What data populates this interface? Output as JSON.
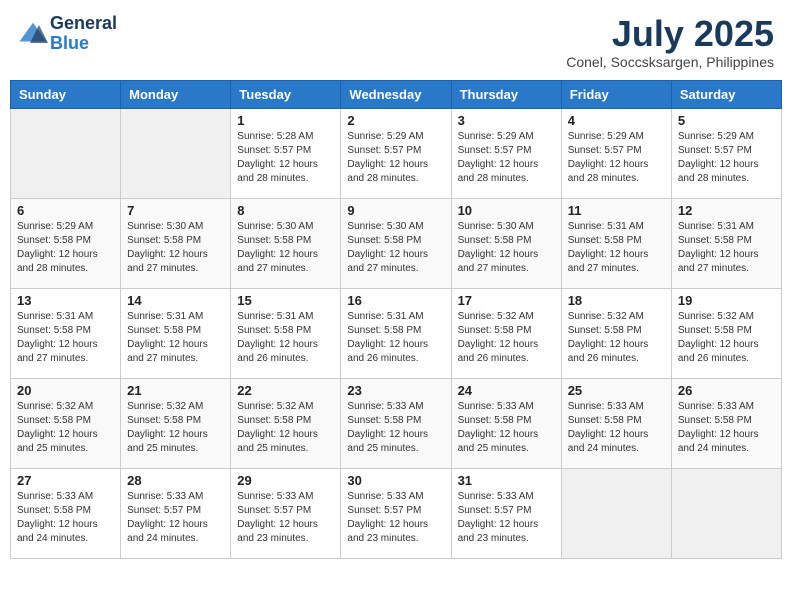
{
  "logo": {
    "line1": "General",
    "line2": "Blue"
  },
  "title": "July 2025",
  "subtitle": "Conel, Soccsksargen, Philippines",
  "weekdays": [
    "Sunday",
    "Monday",
    "Tuesday",
    "Wednesday",
    "Thursday",
    "Friday",
    "Saturday"
  ],
  "weeks": [
    [
      {
        "day": "",
        "sunrise": "",
        "sunset": "",
        "daylight": ""
      },
      {
        "day": "",
        "sunrise": "",
        "sunset": "",
        "daylight": ""
      },
      {
        "day": "1",
        "sunrise": "Sunrise: 5:28 AM",
        "sunset": "Sunset: 5:57 PM",
        "daylight": "Daylight: 12 hours and 28 minutes."
      },
      {
        "day": "2",
        "sunrise": "Sunrise: 5:29 AM",
        "sunset": "Sunset: 5:57 PM",
        "daylight": "Daylight: 12 hours and 28 minutes."
      },
      {
        "day": "3",
        "sunrise": "Sunrise: 5:29 AM",
        "sunset": "Sunset: 5:57 PM",
        "daylight": "Daylight: 12 hours and 28 minutes."
      },
      {
        "day": "4",
        "sunrise": "Sunrise: 5:29 AM",
        "sunset": "Sunset: 5:57 PM",
        "daylight": "Daylight: 12 hours and 28 minutes."
      },
      {
        "day": "5",
        "sunrise": "Sunrise: 5:29 AM",
        "sunset": "Sunset: 5:57 PM",
        "daylight": "Daylight: 12 hours and 28 minutes."
      }
    ],
    [
      {
        "day": "6",
        "sunrise": "Sunrise: 5:29 AM",
        "sunset": "Sunset: 5:58 PM",
        "daylight": "Daylight: 12 hours and 28 minutes."
      },
      {
        "day": "7",
        "sunrise": "Sunrise: 5:30 AM",
        "sunset": "Sunset: 5:58 PM",
        "daylight": "Daylight: 12 hours and 27 minutes."
      },
      {
        "day": "8",
        "sunrise": "Sunrise: 5:30 AM",
        "sunset": "Sunset: 5:58 PM",
        "daylight": "Daylight: 12 hours and 27 minutes."
      },
      {
        "day": "9",
        "sunrise": "Sunrise: 5:30 AM",
        "sunset": "Sunset: 5:58 PM",
        "daylight": "Daylight: 12 hours and 27 minutes."
      },
      {
        "day": "10",
        "sunrise": "Sunrise: 5:30 AM",
        "sunset": "Sunset: 5:58 PM",
        "daylight": "Daylight: 12 hours and 27 minutes."
      },
      {
        "day": "11",
        "sunrise": "Sunrise: 5:31 AM",
        "sunset": "Sunset: 5:58 PM",
        "daylight": "Daylight: 12 hours and 27 minutes."
      },
      {
        "day": "12",
        "sunrise": "Sunrise: 5:31 AM",
        "sunset": "Sunset: 5:58 PM",
        "daylight": "Daylight: 12 hours and 27 minutes."
      }
    ],
    [
      {
        "day": "13",
        "sunrise": "Sunrise: 5:31 AM",
        "sunset": "Sunset: 5:58 PM",
        "daylight": "Daylight: 12 hours and 27 minutes."
      },
      {
        "day": "14",
        "sunrise": "Sunrise: 5:31 AM",
        "sunset": "Sunset: 5:58 PM",
        "daylight": "Daylight: 12 hours and 27 minutes."
      },
      {
        "day": "15",
        "sunrise": "Sunrise: 5:31 AM",
        "sunset": "Sunset: 5:58 PM",
        "daylight": "Daylight: 12 hours and 26 minutes."
      },
      {
        "day": "16",
        "sunrise": "Sunrise: 5:31 AM",
        "sunset": "Sunset: 5:58 PM",
        "daylight": "Daylight: 12 hours and 26 minutes."
      },
      {
        "day": "17",
        "sunrise": "Sunrise: 5:32 AM",
        "sunset": "Sunset: 5:58 PM",
        "daylight": "Daylight: 12 hours and 26 minutes."
      },
      {
        "day": "18",
        "sunrise": "Sunrise: 5:32 AM",
        "sunset": "Sunset: 5:58 PM",
        "daylight": "Daylight: 12 hours and 26 minutes."
      },
      {
        "day": "19",
        "sunrise": "Sunrise: 5:32 AM",
        "sunset": "Sunset: 5:58 PM",
        "daylight": "Daylight: 12 hours and 26 minutes."
      }
    ],
    [
      {
        "day": "20",
        "sunrise": "Sunrise: 5:32 AM",
        "sunset": "Sunset: 5:58 PM",
        "daylight": "Daylight: 12 hours and 25 minutes."
      },
      {
        "day": "21",
        "sunrise": "Sunrise: 5:32 AM",
        "sunset": "Sunset: 5:58 PM",
        "daylight": "Daylight: 12 hours and 25 minutes."
      },
      {
        "day": "22",
        "sunrise": "Sunrise: 5:32 AM",
        "sunset": "Sunset: 5:58 PM",
        "daylight": "Daylight: 12 hours and 25 minutes."
      },
      {
        "day": "23",
        "sunrise": "Sunrise: 5:33 AM",
        "sunset": "Sunset: 5:58 PM",
        "daylight": "Daylight: 12 hours and 25 minutes."
      },
      {
        "day": "24",
        "sunrise": "Sunrise: 5:33 AM",
        "sunset": "Sunset: 5:58 PM",
        "daylight": "Daylight: 12 hours and 25 minutes."
      },
      {
        "day": "25",
        "sunrise": "Sunrise: 5:33 AM",
        "sunset": "Sunset: 5:58 PM",
        "daylight": "Daylight: 12 hours and 24 minutes."
      },
      {
        "day": "26",
        "sunrise": "Sunrise: 5:33 AM",
        "sunset": "Sunset: 5:58 PM",
        "daylight": "Daylight: 12 hours and 24 minutes."
      }
    ],
    [
      {
        "day": "27",
        "sunrise": "Sunrise: 5:33 AM",
        "sunset": "Sunset: 5:58 PM",
        "daylight": "Daylight: 12 hours and 24 minutes."
      },
      {
        "day": "28",
        "sunrise": "Sunrise: 5:33 AM",
        "sunset": "Sunset: 5:57 PM",
        "daylight": "Daylight: 12 hours and 24 minutes."
      },
      {
        "day": "29",
        "sunrise": "Sunrise: 5:33 AM",
        "sunset": "Sunset: 5:57 PM",
        "daylight": "Daylight: 12 hours and 23 minutes."
      },
      {
        "day": "30",
        "sunrise": "Sunrise: 5:33 AM",
        "sunset": "Sunset: 5:57 PM",
        "daylight": "Daylight: 12 hours and 23 minutes."
      },
      {
        "day": "31",
        "sunrise": "Sunrise: 5:33 AM",
        "sunset": "Sunset: 5:57 PM",
        "daylight": "Daylight: 12 hours and 23 minutes."
      },
      {
        "day": "",
        "sunrise": "",
        "sunset": "",
        "daylight": ""
      },
      {
        "day": "",
        "sunrise": "",
        "sunset": "",
        "daylight": ""
      }
    ]
  ]
}
